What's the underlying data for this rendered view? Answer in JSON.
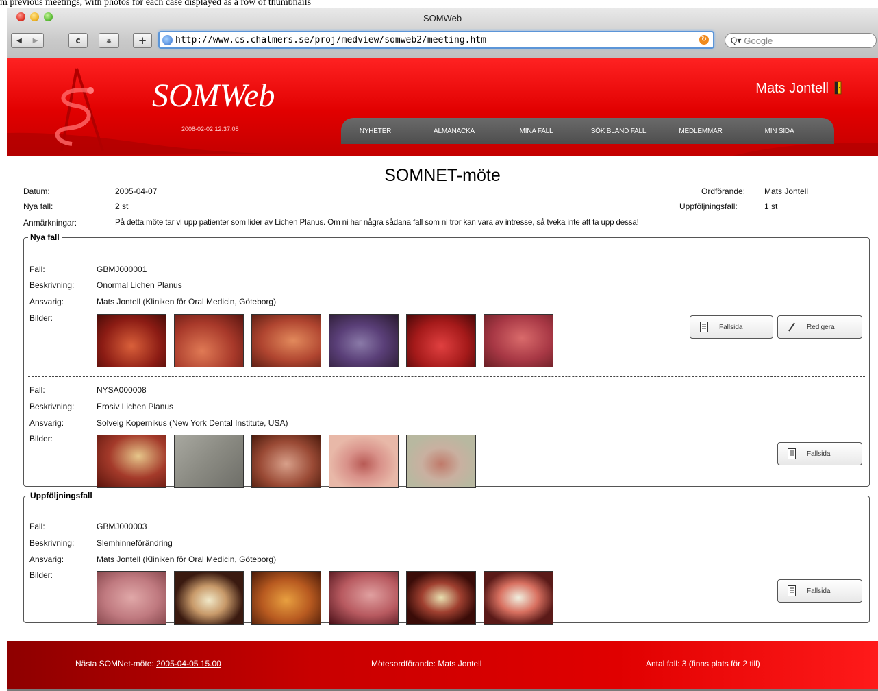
{
  "caption": "m previous meetings, with photos for each case displayed as a row of thumbnails",
  "browser": {
    "window_title": "SOMWeb",
    "url": "http://www.cs.chalmers.se/proj/medview/somweb2/meeting.htm",
    "search_placeholder": "Google",
    "search_icon_label": "Q▾",
    "back_glyph": "◀",
    "forward_glyph": "▶",
    "reload_glyph": "c",
    "snapback_glyph": "⨳",
    "addbookmark_glyph": "+"
  },
  "site": {
    "brand": "SOMWeb",
    "datetime": "2008-02-02 12:37:08",
    "user": "Mats Jontell",
    "nav": [
      "NYHETER",
      "ALMANACKA",
      "MINA FALL",
      "SÖK BLAND FALL",
      "MEDLEMMAR",
      "MIN SIDA"
    ]
  },
  "page": {
    "title": "SOMNET-möte",
    "labels": {
      "datum": "Datum:",
      "nya_fall": "Nya fall:",
      "anmarkningar": "Anmärkningar:",
      "ordforande": "Ordförande:",
      "uppfoljningsfall": "Uppföljningsfall:"
    },
    "values": {
      "datum": "2005-04-07",
      "nya_fall": "2 st",
      "anmarkningar": "På detta möte tar vi upp patienter som lider av Lichen Planus. Om ni har några sådana fall som ni tror kan vara av intresse, så tveka inte att ta upp dessa!",
      "ordforande": "Mats Jontell",
      "uppfoljningsfall": "1 st"
    }
  },
  "case_labels": {
    "fall": "Fall:",
    "beskrivning": "Beskrivning:",
    "ansvarig": "Ansvarig:",
    "bilder": "Bilder:"
  },
  "buttons": {
    "fallsida": "Fallsida",
    "redigera": "Redigera"
  },
  "sections": {
    "nya_fall": {
      "legend": "Nya fall",
      "cases": [
        {
          "fall": "GBMJ000001",
          "beskrivning": "Onormal Lichen Planus",
          "ansvarig": "Mats Jontell (Kliniken för Oral Medicin, Göteborg)",
          "image_count": 6
        },
        {
          "fall": "NYSA000008",
          "beskrivning": "Erosiv Lichen Planus",
          "ansvarig": "Solveig Kopernikus (New York Dental Institute, USA)",
          "image_count": 5
        }
      ]
    },
    "uppfoljningsfall": {
      "legend": "Uppföljningsfall",
      "cases": [
        {
          "fall": "GBMJ000003",
          "beskrivning": "Slemhinneförändring",
          "ansvarig": "Mats Jontell (Kliniken för Oral Medicin, Göteborg)",
          "image_count": 6
        }
      ]
    }
  },
  "footer": {
    "next_meeting_label": "Nästa SOMNet-möte:",
    "next_meeting_link": "2005-04-05 15.00",
    "chair": "Mötesordförande: Mats Jontell",
    "count": "Antal fall: 3 (finns plats för 2 till)"
  },
  "colors": {
    "brand_red": "#e10000",
    "nav_gray": "#555555",
    "footer_dark_red": "#8e0000"
  }
}
